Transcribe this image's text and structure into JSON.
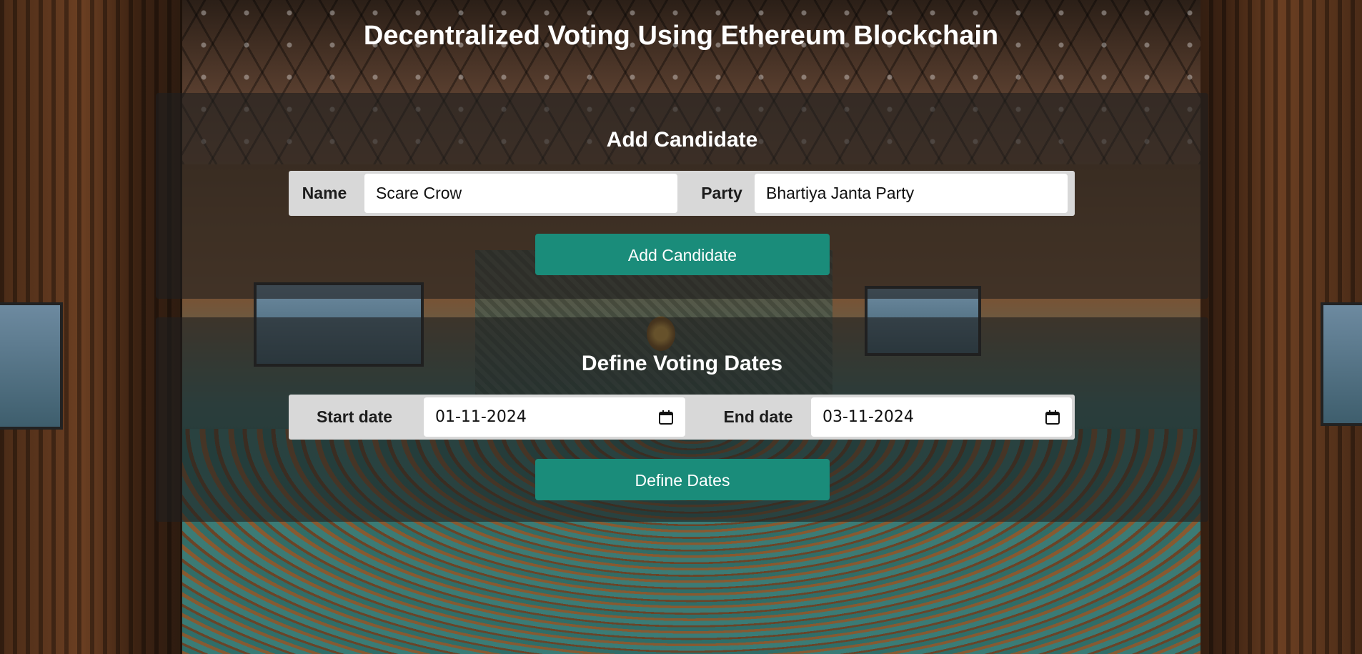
{
  "header": {
    "title": "Decentralized Voting Using Ethereum Blockchain"
  },
  "add_candidate": {
    "heading": "Add Candidate",
    "name_label": "Name",
    "name_value": "Scare Crow",
    "party_label": "Party",
    "party_value": "Bhartiya Janta Party",
    "button_label": "Add Candidate"
  },
  "voting_dates": {
    "heading": "Define Voting Dates",
    "start_label": "Start date",
    "start_value": "01-11-2024",
    "end_label": "End date",
    "end_value": "03-11-2024",
    "button_label": "Define Dates"
  },
  "icons": {
    "calendar": "calendar-icon"
  },
  "colors": {
    "accent": "#1a8c7a",
    "panel": "rgba(30,30,30,0.62)",
    "field_row": "#d8d8d8"
  }
}
